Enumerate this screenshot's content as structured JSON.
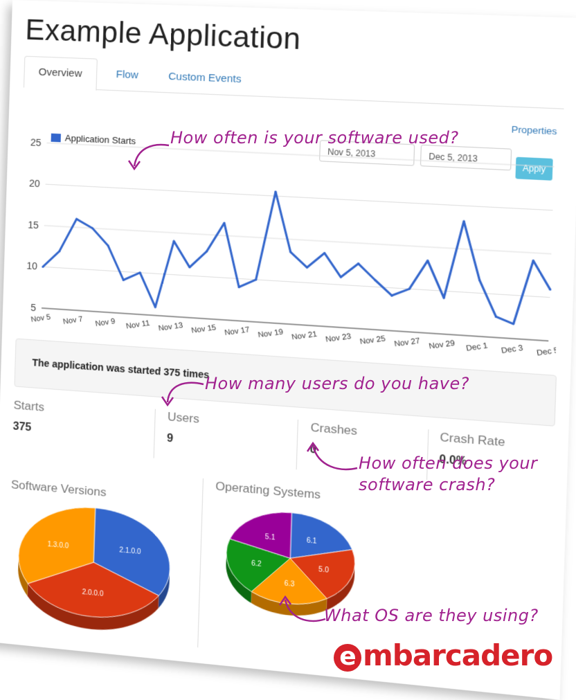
{
  "app": {
    "title": "Example Application"
  },
  "tabs": [
    "Overview",
    "Flow",
    "Custom Events"
  ],
  "properties_link": "Properties",
  "date_range": {
    "start": "Nov 5, 2013",
    "end": "Dec 5, 2013",
    "apply_label": "Apply"
  },
  "chart_data": {
    "type": "line",
    "title": "",
    "series": [
      {
        "name": "Application Starts",
        "color": "#3366cc",
        "values": [
          10,
          12,
          16,
          15,
          13,
          9,
          10,
          6,
          14,
          11,
          13,
          16.5,
          9,
          10,
          20.5,
          13.5,
          11.8,
          13.6,
          10.9,
          12.6,
          10.8,
          9.1,
          10,
          13.4,
          9.2,
          18.2,
          11.5,
          7.4,
          6.7,
          14.1,
          10.9
        ]
      }
    ],
    "x_tick_labels": [
      "Nov 5",
      "Nov 7",
      "Nov 9",
      "Nov 11",
      "Nov 13",
      "Nov 15",
      "Nov 17",
      "Nov 19",
      "Nov 21",
      "Nov 23",
      "Nov 25",
      "Nov 27",
      "Nov 29",
      "Dec 1",
      "Dec 3",
      "Dec 5"
    ],
    "y_ticks": [
      5,
      10,
      15,
      20,
      25
    ],
    "ylim": [
      5,
      25
    ],
    "legend": "top-left",
    "grid": true
  },
  "summary": {
    "text": "The application was started 375 times"
  },
  "stats": [
    {
      "label": "Starts",
      "value": "375"
    },
    {
      "label": "Users",
      "value": "9"
    },
    {
      "label": "Crashes",
      "value": "0"
    },
    {
      "label": "Crash Rate",
      "value": "0.0%"
    }
  ],
  "software_versions": {
    "title": "Software Versions",
    "slices": [
      {
        "label": "2.1.0.0",
        "value": 33.3,
        "color": "#3366cc"
      },
      {
        "label": "2.0.0.0",
        "value": 33.3,
        "color": "#dc3912"
      },
      {
        "label": "1.3.0.0",
        "value": 33.4,
        "color": "#ff9900"
      }
    ]
  },
  "operating_systems": {
    "title": "Operating Systems",
    "slices": [
      {
        "label": "6.1",
        "value": 20,
        "color": "#3366cc"
      },
      {
        "label": "5.0",
        "value": 20,
        "color": "#dc3912"
      },
      {
        "label": "6.3",
        "value": 20,
        "color": "#ff9900"
      },
      {
        "label": "6.2",
        "value": 20,
        "color": "#109618"
      },
      {
        "label": "5.1",
        "value": 20,
        "color": "#990099"
      }
    ]
  },
  "annotations": {
    "usage": "How often is your software used?",
    "users": "How many users do you have?",
    "crash_line1": "How often does your",
    "crash_line2": "software crash?",
    "os": "What OS are they using?"
  },
  "brand": {
    "logo_text": "embarcadero",
    "color": "#d6222a"
  }
}
